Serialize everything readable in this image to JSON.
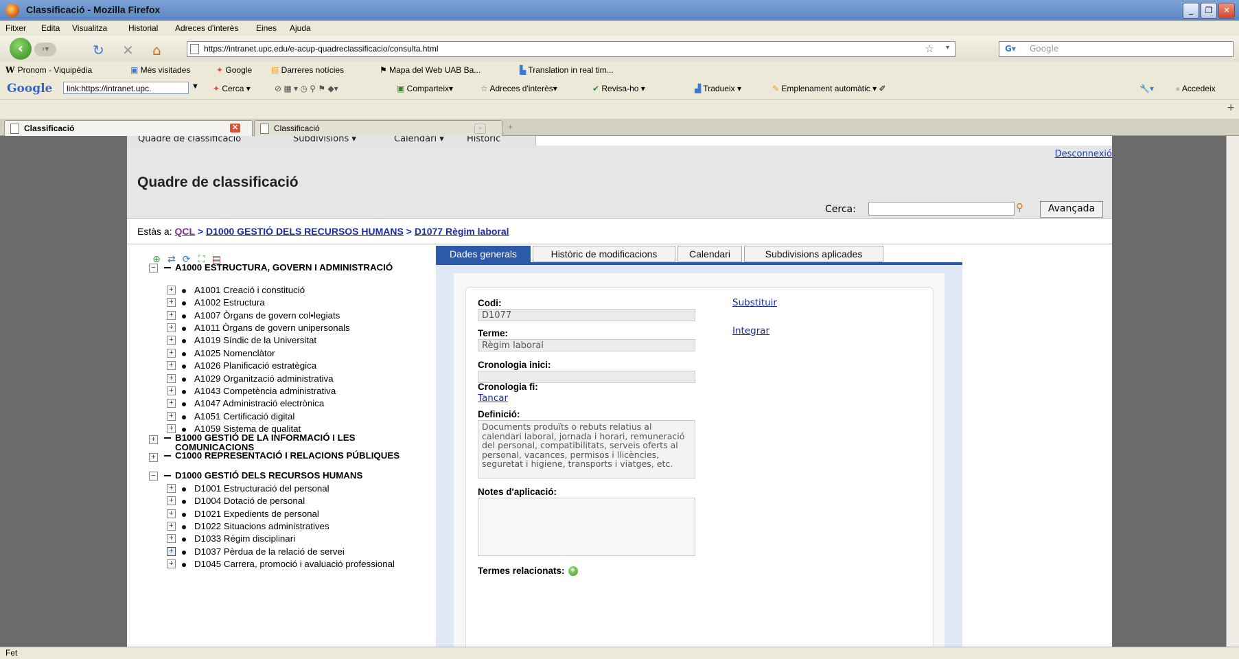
{
  "window": {
    "title": "Classificació - Mozilla Firefox"
  },
  "menu": [
    "Fitxer",
    "Edita",
    "Visualitza",
    "Historial",
    "Adreces d'interès",
    "Eines",
    "Ajuda"
  ],
  "nav": {
    "url": "https://intranet.upc.edu/e-acup-quadreclassificacio/consulta.html",
    "search_placeholder": "Google"
  },
  "bookmarks": [
    "Pronom - Viquipèdia",
    "Més visitades",
    "Google",
    "Darreres notícies",
    "Mapa del Web UAB Ba...",
    "Translation in real tim..."
  ],
  "google_toolbar": {
    "logo": "Google",
    "input_value": "link:https://intranet.upc.",
    "items": [
      "Cerca",
      "Comparteix",
      "Adreces d'interès",
      "Revisa-ho",
      "Tradueix",
      "Emplenament automàtic",
      "Accedeix"
    ]
  },
  "tabs": [
    {
      "label": "Classificació",
      "active": true
    },
    {
      "label": "Classificació",
      "active": false
    }
  ],
  "app_nav": [
    "Quadre de classificació",
    "Subdivisions ▾",
    "Calendari ▾",
    "Històric"
  ],
  "header": {
    "logout": "Desconnexió",
    "title": "Quadre de classificació",
    "search_label": "Cerca:",
    "advanced": "Avançada"
  },
  "breadcrumb": {
    "prefix": "Estàs a:",
    "items": [
      "QCL",
      "D1000 GESTIÓ DELS RECURSOS HUMANS",
      "D1077 Règim laboral"
    ],
    "sep": ">"
  },
  "tree": {
    "a": {
      "root": "A1000 ESTRUCTURA, GOVERN I ADMINISTRACIÓ",
      "children": [
        "A1001 Creació i constitució",
        "A1002 Estructura",
        "A1007 Òrgans de govern col•legiats",
        "A1011 Òrgans de govern unipersonals",
        "A1019 Síndic de la Universitat",
        "A1025 Nomenclàtor",
        "A1026 Planificació estratègica",
        "A1029 Organització administrativa",
        "A1043 Competència administrativa",
        "A1047 Administració electrònica",
        "A1051 Certificació digital",
        "A1059 Sistema de qualitat"
      ]
    },
    "b": {
      "root": "B1000 GESTIÓ DE LA INFORMACIÓ I LES COMUNICACIONS"
    },
    "c": {
      "root": "C1000 REPRESENTACIÓ I RELACIONS PÚBLIQUES"
    },
    "d": {
      "root": "D1000 GESTIÓ DELS RECURSOS HUMANS",
      "children": [
        "D1001 Estructuració del personal",
        "D1004 Dotació de personal",
        "D1021 Expedients de personal",
        "D1022 Situacions administratives",
        "D1033 Règim disciplinari",
        "D1037 Pèrdua de la relació de servei",
        "D1045 Carrera, promoció i avaluació professional"
      ]
    }
  },
  "detail_tabs": [
    "Dades generals",
    "Històric de modificacions",
    "Calendari",
    "Subdivisions aplicades"
  ],
  "form": {
    "codi_label": "Codi:",
    "codi_value": "D1077",
    "substituir": "Substituir",
    "integrar": "Integrar",
    "terme_label": "Terme:",
    "terme_value": "Règim laboral",
    "cron_inici_label": "Cronologia inici:",
    "cron_inici_value": "",
    "cron_fi_label": "Cronologia fi:",
    "tancar": "Tancar",
    "definicio_label": "Definició:",
    "definicio_value": "Documents produïts o rebuts relatius al calendari laboral, jornada i horari, remuneració del personal, compatibilitats, serveis oferts al personal, vacances, permisos i llicències, seguretat i higiene, transports i viatges, etc.",
    "notes_label": "Notes d'aplicació:",
    "termes_label": "Termes relacionats:"
  },
  "status": "Fet"
}
